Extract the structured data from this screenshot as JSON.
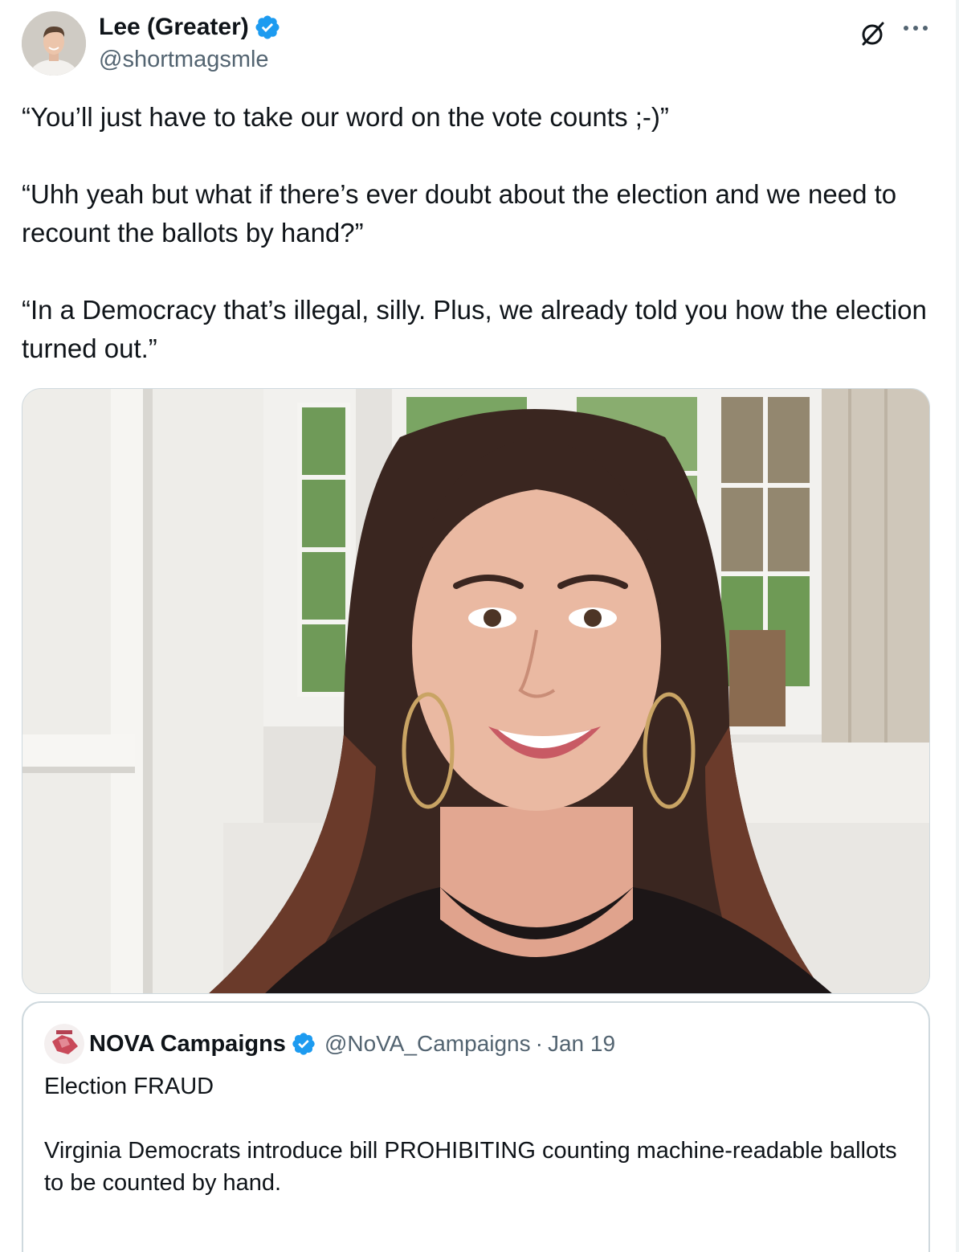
{
  "author": {
    "display_name": "Lee (Greater)",
    "handle": "@shortmagsmle",
    "verified": true,
    "verified_color": "#1d9bf0"
  },
  "tweet": {
    "paragraphs": [
      "“You’ll just have to take our word on the vote counts ;-)”",
      "“Uhh yeah but what if there’s ever doubt about the election and we need to recount the ballots by hand?”",
      "“In a Democracy that’s illegal, silly. Plus, we already told you how the election turned out.”"
    ]
  },
  "icons": {
    "grok": "grok-slash-circle-icon",
    "more": "more-horizontal-icon",
    "verified": "verified-badge-icon"
  },
  "quoted_tweet": {
    "display_name": "NOVA Campaigns",
    "handle": "@NoVA_Campaigns",
    "separator": "·",
    "date": "Jan 19",
    "verified": true,
    "paragraphs": [
      "Election FRAUD",
      "Virginia Democrats introduce bill PROHIBITING counting machine-readable ballots to be counted by hand."
    ]
  },
  "colors": {
    "text": "#0f1419",
    "secondary": "#536471",
    "border": "#cfd9de"
  }
}
